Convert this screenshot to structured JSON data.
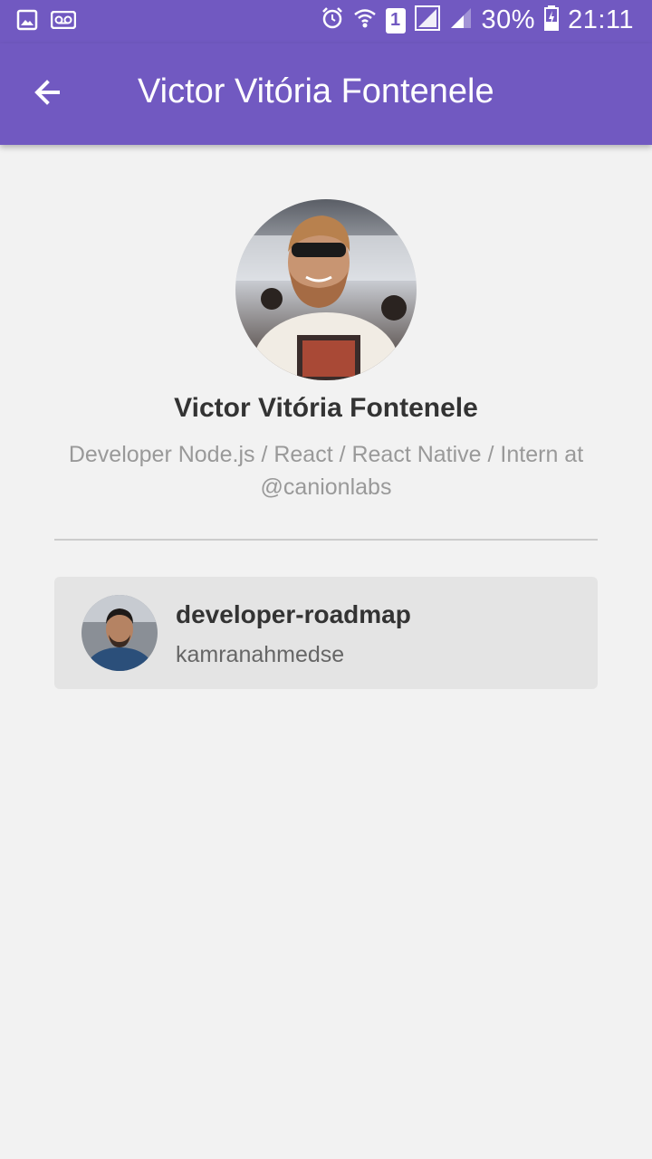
{
  "status_bar": {
    "battery": "30%",
    "time": "21:11",
    "sim_label": "1",
    "icons": [
      "image-icon",
      "voicemail-icon",
      "alarm-icon",
      "wifi-icon",
      "sim-icon",
      "signal-icon",
      "signal-icon",
      "battery-charging-icon"
    ]
  },
  "app_bar": {
    "title": "Victor Vitória Fontenele",
    "back_icon": "arrow-left-icon",
    "color": "#7159c1"
  },
  "profile": {
    "name": "Victor Vitória Fontenele",
    "bio": "Developer Node.js / React / React Native / Intern at @canionlabs"
  },
  "starred": [
    {
      "repo": "developer-roadmap",
      "owner": "kamranahmedse"
    }
  ]
}
